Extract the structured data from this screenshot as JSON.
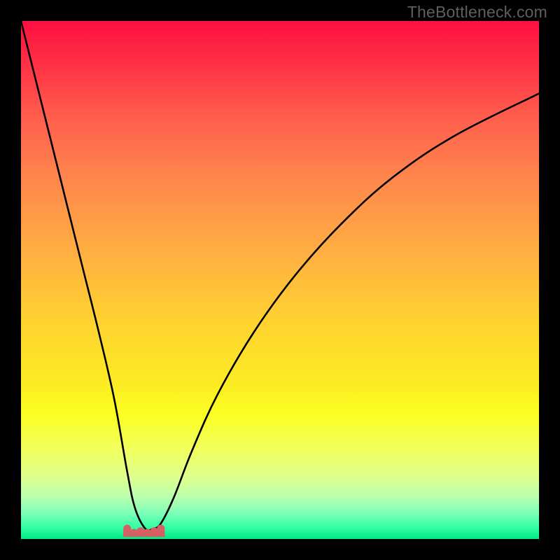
{
  "watermark": "TheBottleneck.com",
  "chart_data": {
    "type": "line",
    "title": "",
    "xlabel": "",
    "ylabel": "",
    "xlim": [
      0,
      100
    ],
    "ylim": [
      0,
      100
    ],
    "gradient_bg": {
      "stops": [
        {
          "pct": 0,
          "color": "#fe1041"
        },
        {
          "pct": 50,
          "color": "#ffd230"
        },
        {
          "pct": 75,
          "color": "#fbff23"
        },
        {
          "pct": 100,
          "color": "#00ec86"
        }
      ]
    },
    "series": [
      {
        "name": "curve",
        "color": "#000000",
        "x": [
          0,
          3,
          6,
          9,
          12,
          15,
          18,
          20.5,
          22,
          24,
          25.5,
          27,
          29.5,
          33,
          38,
          45,
          53,
          62,
          72,
          84,
          100
        ],
        "y": [
          100,
          88,
          76,
          64,
          52,
          40,
          27,
          13,
          6,
          2,
          2,
          3,
          8,
          17,
          28,
          40,
          51,
          61,
          70,
          78,
          86
        ]
      }
    ],
    "bucket_marker": {
      "color": "#d65f64",
      "segment_x": [
        20.5,
        27.0
      ],
      "nub_count": 6,
      "nub_y_offset": 6
    }
  }
}
